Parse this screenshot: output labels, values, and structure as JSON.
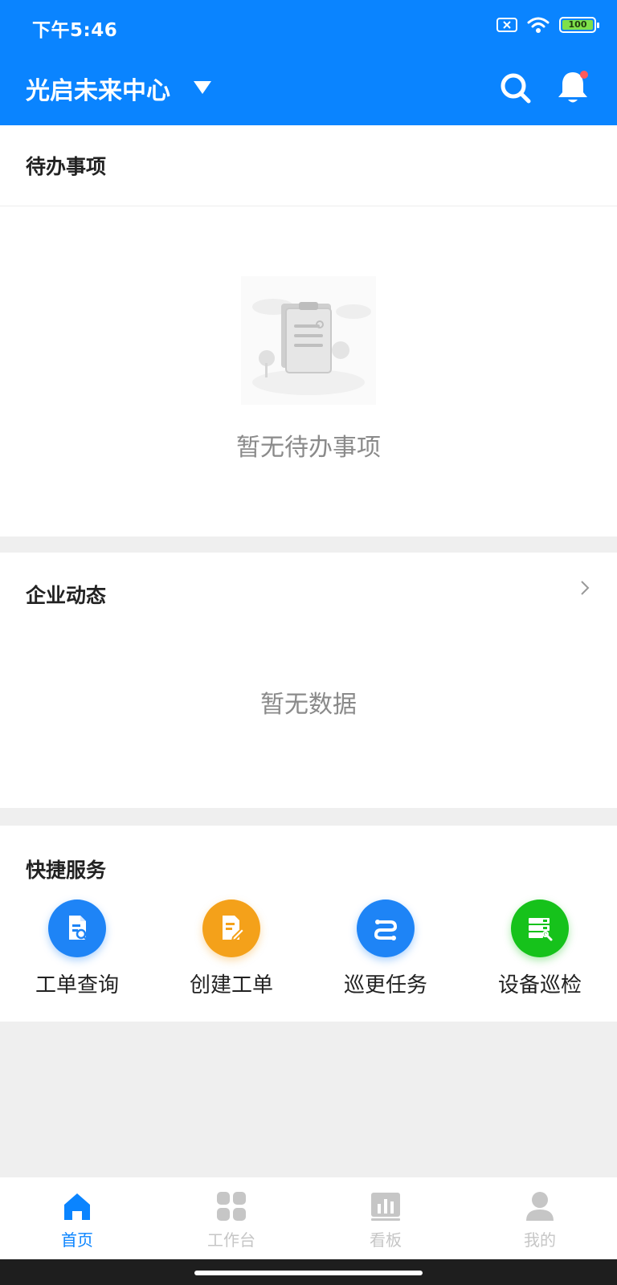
{
  "status_bar": {
    "time": "下午5:46",
    "battery": "100"
  },
  "header": {
    "center_name": "光启未来中心"
  },
  "todo": {
    "title": "待办事项",
    "empty_text": "暂无待办事项"
  },
  "news": {
    "title": "企业动态",
    "empty_text": "暂无数据"
  },
  "quick": {
    "title": "快捷服务",
    "items": [
      {
        "label": "工单查询",
        "color": "#1e84f6",
        "icon": "document-search-icon"
      },
      {
        "label": "创建工单",
        "color": "#f4a11a",
        "icon": "document-edit-icon"
      },
      {
        "label": "巡更任务",
        "color": "#1e84f6",
        "icon": "route-icon"
      },
      {
        "label": "设备巡检",
        "color": "#16c21b",
        "icon": "server-wrench-icon"
      }
    ]
  },
  "nav": {
    "items": [
      {
        "label": "首页",
        "active": true
      },
      {
        "label": "工作台",
        "active": false
      },
      {
        "label": "看板",
        "active": false
      },
      {
        "label": "我的",
        "active": false
      }
    ]
  },
  "colors": {
    "brand": "#0a84ff",
    "notif": "#ff5a5a",
    "nav_inactive": "#c6c6c6"
  }
}
